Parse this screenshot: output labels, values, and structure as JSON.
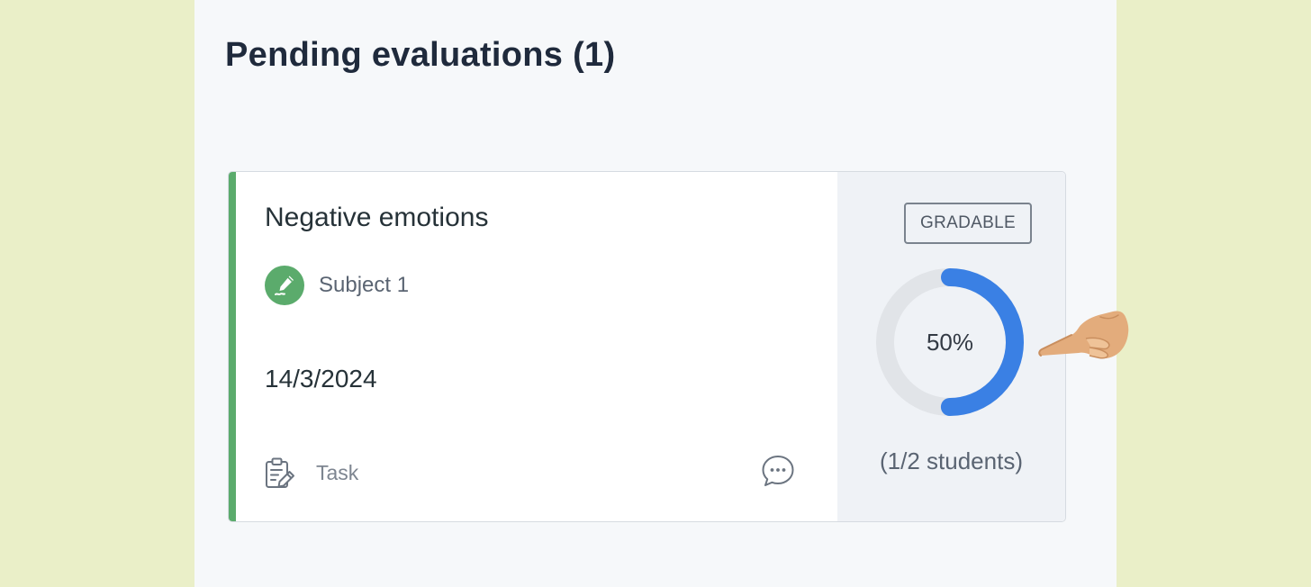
{
  "page": {
    "title": "Pending evaluations (1)"
  },
  "card": {
    "title": "Negative emotions",
    "subject": "Subject 1",
    "subject_icon": "pen-icon",
    "date": "14/3/2024",
    "type_label": "Task",
    "type_icon": "clipboard-edit-icon",
    "comment_icon": "comment-icon",
    "badge": "GRADABLE",
    "progress_percent": 50,
    "progress_text": "50%",
    "students_text": "(1/2 students)"
  },
  "colors": {
    "accent": "#5bab6c",
    "progress": "#3a80e4",
    "track": "#e1e4e8",
    "background": "#eaefc8",
    "panel": "#f6f8fa"
  }
}
